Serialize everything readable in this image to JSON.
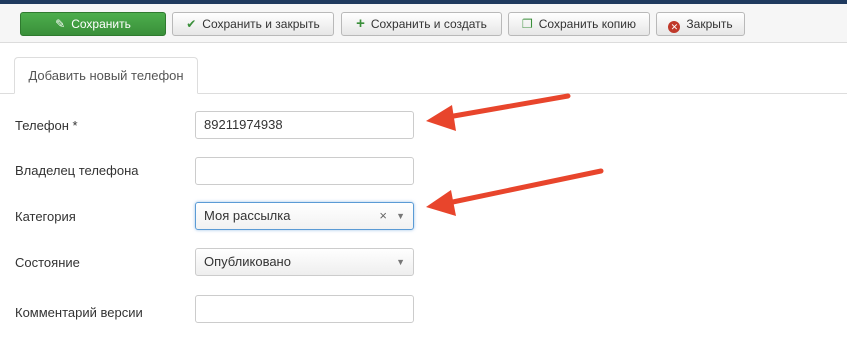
{
  "toolbar": {
    "save": "Сохранить",
    "save_close": "Сохранить и закрыть",
    "save_new": "Сохранить и создать",
    "save_copy": "Сохранить копию",
    "close": "Закрыть"
  },
  "tab": {
    "label": "Добавить новый телефон"
  },
  "form": {
    "phone": {
      "label": "Телефон *",
      "value": "89211974938"
    },
    "owner": {
      "label": "Владелец телефона",
      "value": ""
    },
    "category": {
      "label": "Категория",
      "value": "Моя рассылка",
      "clear": "×"
    },
    "state": {
      "label": "Состояние",
      "value": "Опубликовано"
    },
    "comment": {
      "label": "Комментарий версии",
      "value": ""
    }
  },
  "colors": {
    "accent_green": "#3a8f3a",
    "focus_blue": "#5b9bd5",
    "arrow_red": "#e8452c"
  },
  "icons": [
    "edit-icon",
    "check-icon",
    "plus-icon",
    "copy-icon",
    "close-icon",
    "clear-icon",
    "chevron-down-icon"
  ]
}
